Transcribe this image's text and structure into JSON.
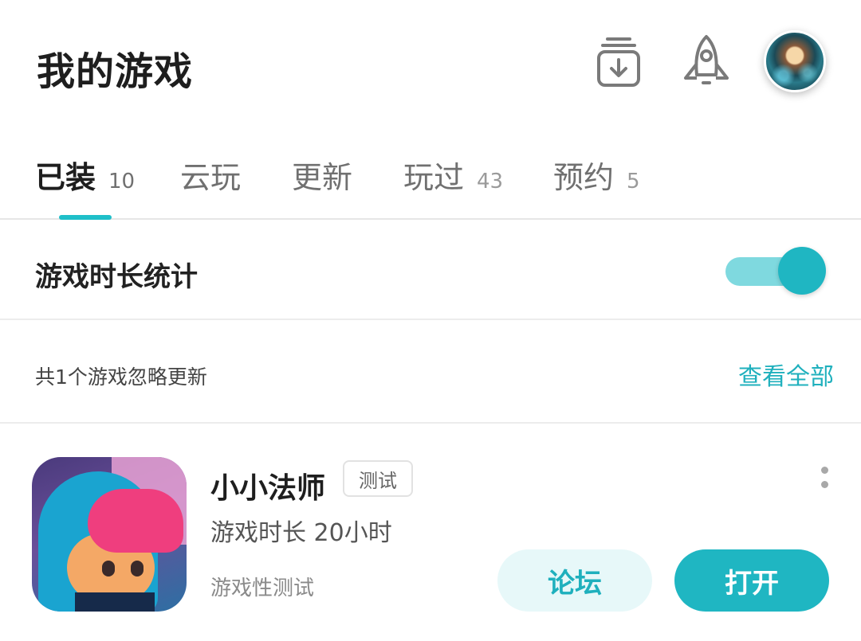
{
  "header": {
    "title": "我的游戏",
    "icons": {
      "download": "download-box-icon",
      "rocket": "rocket-icon",
      "avatar": "user-avatar"
    }
  },
  "tabs": [
    {
      "label": "已装",
      "count": "10",
      "active": true
    },
    {
      "label": "云玩",
      "count": ""
    },
    {
      "label": "更新",
      "count": ""
    },
    {
      "label": "玩过",
      "count": "43"
    },
    {
      "label": "预约",
      "count": "5"
    }
  ],
  "stat_row": {
    "label": "游戏时长统计",
    "toggle_on": true
  },
  "ignore_row": {
    "text": "共1个游戏忽略更新",
    "link": "查看全部"
  },
  "game": {
    "name": "小小法师",
    "badge": "测试",
    "play_time": "游戏时长 20小时",
    "test_type": "游戏性测试",
    "forum_button": "论坛",
    "open_button": "打开"
  },
  "colors": {
    "accent": "#1fb6c2",
    "accent_light": "#e7f8f9",
    "toggle_track": "#7fd9df"
  }
}
